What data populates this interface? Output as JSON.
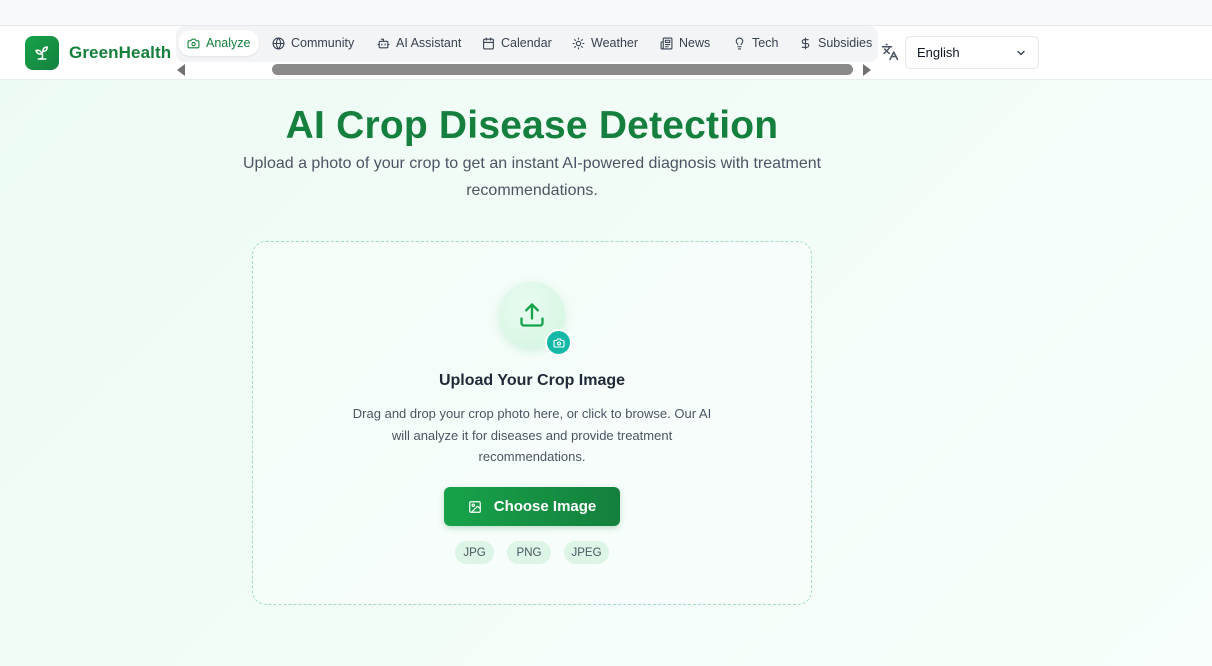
{
  "app": {
    "brand_name": "GreenHealth"
  },
  "nav": {
    "tabs": [
      {
        "label": "Analyze",
        "icon": "camera-icon",
        "active": true
      },
      {
        "label": "Community",
        "icon": "globe-icon"
      },
      {
        "label": "AI Assistant",
        "icon": "bot-icon"
      },
      {
        "label": "Calendar",
        "icon": "calendar-icon"
      },
      {
        "label": "Weather",
        "icon": "sun-icon"
      },
      {
        "label": "News",
        "icon": "newspaper-icon"
      },
      {
        "label": "Tech",
        "icon": "lightbulb-icon"
      },
      {
        "label": "Subsidies",
        "icon": "dollar-icon"
      }
    ],
    "language": {
      "selected": "English",
      "icon": "translate-icon"
    }
  },
  "hero": {
    "title": "AI Crop Disease Detection",
    "subtitle": "Upload a photo of your crop to get an instant AI-powered diagnosis with treatment recommendations."
  },
  "upload": {
    "title": "Upload Your Crop Image",
    "description": "Drag and drop your crop photo here, or click to browse. Our AI will analyze it for diseases and provide treatment recommendations.",
    "button_label": "Choose Image",
    "formats": [
      "JPG",
      "PNG",
      "JPEG"
    ]
  },
  "colors": {
    "brand_green": "#15803d",
    "accent_green": "#16a34a",
    "teal_badge": "#14b8a6",
    "background": "#ecfbf3"
  }
}
